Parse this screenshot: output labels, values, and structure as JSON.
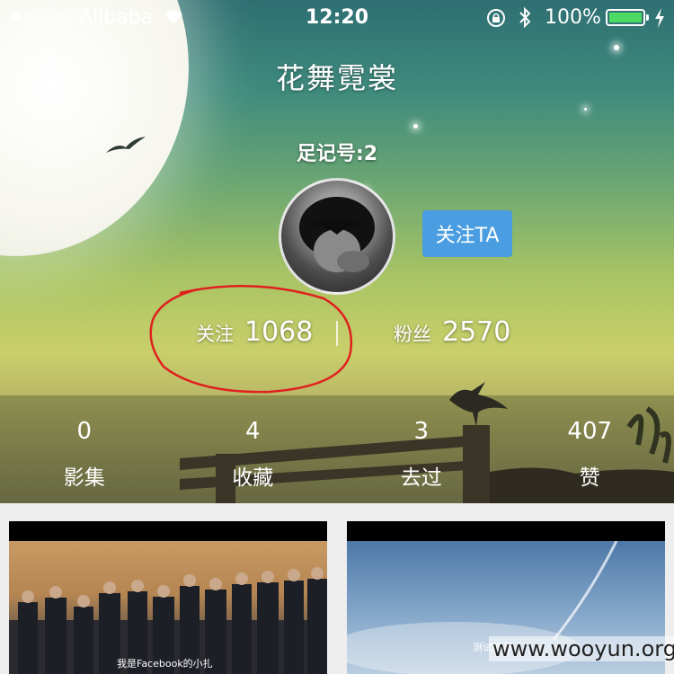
{
  "status_bar": {
    "carrier": "Alibaba",
    "time": "12:20",
    "battery_percent": "100%",
    "battery_level": 1.0,
    "signal_bars": 1,
    "signal_total": 5
  },
  "nav": {
    "back_icon": "chevron-left-icon",
    "title": "花舞霓裳"
  },
  "profile": {
    "footprint_id": "足记号:2",
    "follow_button": "关注TA",
    "following_label": "关注",
    "following_count": "1068",
    "fans_label": "粉丝",
    "fans_count": "2570"
  },
  "counts": [
    {
      "value": "0",
      "label": "影集"
    },
    {
      "value": "4",
      "label": "收藏"
    },
    {
      "value": "3",
      "label": "去过"
    },
    {
      "value": "407",
      "label": "赞"
    }
  ],
  "cards": [
    {
      "caption": "我是Facebook的小扎"
    },
    {
      "caption": "测试推荐"
    }
  ],
  "watermark": "www.wooyun.org",
  "colors": {
    "follow_button": "#4a9de0",
    "battery": "#4cd964",
    "annotation": "#e0201e"
  }
}
